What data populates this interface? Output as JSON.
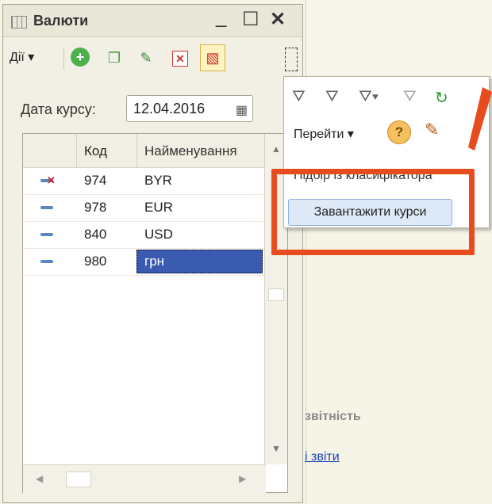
{
  "window": {
    "title": "Валюти"
  },
  "toolbar": {
    "actions_label": "Дії ▾"
  },
  "date": {
    "label": "Дата курсу:",
    "value": "12.04.2016"
  },
  "table": {
    "columns": [
      "Код",
      "Найменування"
    ],
    "rows": [
      {
        "code": "974",
        "name": "BYR",
        "status": "deleted"
      },
      {
        "code": "978",
        "name": "EUR",
        "status": "normal"
      },
      {
        "code": "840",
        "name": "USD",
        "status": "normal"
      },
      {
        "code": "980",
        "name": "грн",
        "status": "normal",
        "selected": true
      }
    ]
  },
  "popup": {
    "goto_label": "Перейти ▾",
    "help_label": "?",
    "pick_from_classifier": "Підбір із класифікатора",
    "load_rates_label": "Завантажити курси"
  },
  "background": {
    "heading": "звітність",
    "link": "і звіти"
  },
  "colors": {
    "highlight": "#e74c1e",
    "selection": "#3a5bb0"
  }
}
